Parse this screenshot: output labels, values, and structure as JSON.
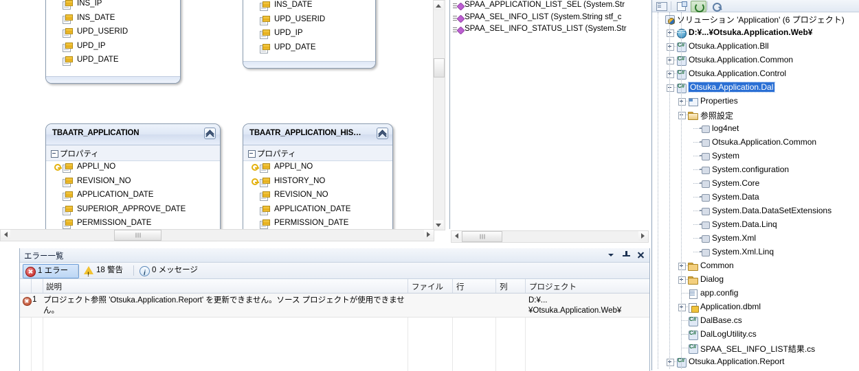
{
  "designer": {
    "entities": [
      {
        "name": "",
        "title_visible": false,
        "properties": [
          "INS_IP",
          "INS_DATE",
          "UPD_USERID",
          "UPD_IP",
          "UPD_DATE"
        ]
      },
      {
        "name": "",
        "title_visible": false,
        "properties": [
          "INS_DATE",
          "UPD_USERID",
          "UPD_IP",
          "UPD_DATE"
        ]
      },
      {
        "name": "TBAATR_APPLICATION",
        "compartment": "プロパティ",
        "properties": [
          {
            "label": "APPLI_NO",
            "key": true
          },
          {
            "label": "REVISION_NO",
            "key": false
          },
          {
            "label": "APPLICATION_DATE",
            "key": false
          },
          {
            "label": "SUPERIOR_APPROVE_DATE",
            "key": false
          },
          {
            "label": "PERMISSION_DATE",
            "key": false
          }
        ]
      },
      {
        "name": "TBAATR_APPLICATION_HIS…",
        "compartment": "プロパティ",
        "properties": [
          {
            "label": "APPLI_NO",
            "key": true
          },
          {
            "label": "HISTORY_NO",
            "key": true
          },
          {
            "label": "REVISION_NO",
            "key": false
          },
          {
            "label": "APPLICATION_DATE",
            "key": false
          },
          {
            "label": "PERMISSION_DATE",
            "key": false
          }
        ]
      }
    ],
    "methods": [
      "SPAA_APPLICATION_LIST_SEL (System.Str",
      "SPAA_SEL_INFO_LIST (System.String stf_c",
      "SPAA_SEL_INFO_STATUS_LIST (System.Str"
    ]
  },
  "error_list": {
    "title": "エラー一覧",
    "filters": [
      {
        "label": "1 エラー",
        "icon": "error-icon",
        "selected": true
      },
      {
        "label": "18 警告",
        "icon": "warning-icon",
        "selected": false
      },
      {
        "label": "0 メッセージ",
        "icon": "info-icon",
        "selected": false
      }
    ],
    "columns": [
      "説明",
      "ファイル",
      "行",
      "列",
      "プロジェクト"
    ],
    "rows": [
      {
        "number": "1",
        "icon": "error-icon",
        "description": "プロジェクト参照 'Otsuka.Application.Report' を更新できません。ソース プロジェクトが使用できません。",
        "file": "",
        "line": "",
        "column": "",
        "project": "D:¥...\n¥Otsuka.Application.Web¥"
      }
    ],
    "window_buttons": [
      "chevron-down-icon",
      "pin-icon",
      "close-icon"
    ]
  },
  "solution_explorer": {
    "toolbar_buttons": [
      "properties-icon",
      "show-all-files-icon",
      "refresh-icon",
      "view-code-icon"
    ],
    "tree": [
      {
        "label": "ソリューション 'Application' (6 プロジェクト)",
        "depth": 0,
        "icon": "solution-icon",
        "expander": "none",
        "bold": false,
        "selected": false
      },
      {
        "label": "D:¥...¥Otsuka.Application.Web¥",
        "depth": 1,
        "icon": "web-project-icon",
        "expander": "plus",
        "bold": true,
        "selected": false
      },
      {
        "label": "Otsuka.Application.Bll",
        "depth": 1,
        "icon": "csharp-project-icon",
        "expander": "plus",
        "bold": false,
        "selected": false
      },
      {
        "label": "Otsuka.Application.Common",
        "depth": 1,
        "icon": "csharp-project-icon",
        "expander": "plus",
        "bold": false,
        "selected": false
      },
      {
        "label": "Otsuka.Application.Control",
        "depth": 1,
        "icon": "csharp-project-icon",
        "expander": "plus",
        "bold": false,
        "selected": false
      },
      {
        "label": "Otsuka.Application.Dal",
        "depth": 1,
        "icon": "csharp-project-icon",
        "expander": "minus",
        "bold": false,
        "selected": true
      },
      {
        "label": "Properties",
        "depth": 2,
        "icon": "properties-folder-icon",
        "expander": "plus",
        "bold": false,
        "selected": false
      },
      {
        "label": "参照設定",
        "depth": 2,
        "icon": "references-folder-icon",
        "expander": "minus",
        "bold": false,
        "selected": false
      },
      {
        "label": "log4net",
        "depth": 3,
        "icon": "reference-icon",
        "expander": "none",
        "bold": false,
        "selected": false
      },
      {
        "label": "Otsuka.Application.Common",
        "depth": 3,
        "icon": "reference-icon",
        "expander": "none",
        "bold": false,
        "selected": false
      },
      {
        "label": "System",
        "depth": 3,
        "icon": "reference-icon",
        "expander": "none",
        "bold": false,
        "selected": false
      },
      {
        "label": "System.configuration",
        "depth": 3,
        "icon": "reference-icon",
        "expander": "none",
        "bold": false,
        "selected": false
      },
      {
        "label": "System.Core",
        "depth": 3,
        "icon": "reference-icon",
        "expander": "none",
        "bold": false,
        "selected": false
      },
      {
        "label": "System.Data",
        "depth": 3,
        "icon": "reference-icon",
        "expander": "none",
        "bold": false,
        "selected": false
      },
      {
        "label": "System.Data.DataSetExtensions",
        "depth": 3,
        "icon": "reference-icon",
        "expander": "none",
        "bold": false,
        "selected": false
      },
      {
        "label": "System.Data.Linq",
        "depth": 3,
        "icon": "reference-icon",
        "expander": "none",
        "bold": false,
        "selected": false
      },
      {
        "label": "System.Xml",
        "depth": 3,
        "icon": "reference-icon",
        "expander": "none",
        "bold": false,
        "selected": false
      },
      {
        "label": "System.Xml.Linq",
        "depth": 3,
        "icon": "reference-icon",
        "expander": "none",
        "bold": false,
        "selected": false
      },
      {
        "label": "Common",
        "depth": 2,
        "icon": "folder-icon",
        "expander": "plus",
        "bold": false,
        "selected": false
      },
      {
        "label": "Dialog",
        "depth": 2,
        "icon": "folder-icon",
        "expander": "plus",
        "bold": false,
        "selected": false
      },
      {
        "label": "app.config",
        "depth": 2,
        "icon": "config-file-icon",
        "expander": "none",
        "bold": false,
        "selected": false
      },
      {
        "label": "Application.dbml",
        "depth": 2,
        "icon": "dbml-file-icon",
        "expander": "plus",
        "bold": false,
        "selected": false
      },
      {
        "label": "DalBase.cs",
        "depth": 2,
        "icon": "csharp-file-icon",
        "expander": "none",
        "bold": false,
        "selected": false
      },
      {
        "label": "DalLogUtility.cs",
        "depth": 2,
        "icon": "csharp-file-icon",
        "expander": "none",
        "bold": false,
        "selected": false
      },
      {
        "label": "SPAA_SEL_INFO_LIST結果.cs",
        "depth": 2,
        "icon": "csharp-file-icon",
        "expander": "none",
        "bold": false,
        "selected": false
      },
      {
        "label": "Otsuka.Application.Report",
        "depth": 1,
        "icon": "csharp-project-icon",
        "expander": "plus",
        "bold": false,
        "selected": false
      }
    ]
  },
  "colors": {
    "selection_blue": "#2a6fd4",
    "error_red": "#c0201e",
    "warning_yellow": "#f2c230",
    "chrome_blue": "#dfe8f6"
  }
}
